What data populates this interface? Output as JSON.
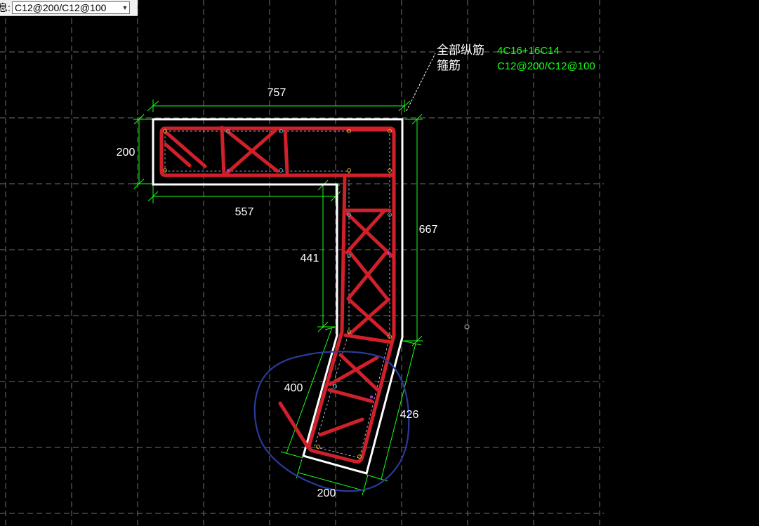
{
  "toolbar": {
    "field_label": "息:",
    "stirrup_value": "C12@200/C12@100"
  },
  "annotation": {
    "longitudinal_label": "全部纵筋",
    "longitudinal_value": "4C16+16C14",
    "stirrup_label": "箍筋",
    "stirrup_value": "C12@200/C12@100"
  },
  "dimensions": {
    "top_width": "757",
    "left_height": "200",
    "inner_bottom": "557",
    "inner_vertical": "441",
    "right_height": "667",
    "diag_inner": "400",
    "diag_outer": "426",
    "bottom_width": "200"
  },
  "colors": {
    "background": "#000000",
    "grid": "#6f6f6f",
    "dimension": "#19ff19",
    "outline": "#ffffff",
    "rebar": "#d1202a",
    "markup": "#2a3a9a",
    "text": "#ffffff",
    "value_text": "#19ff19"
  }
}
